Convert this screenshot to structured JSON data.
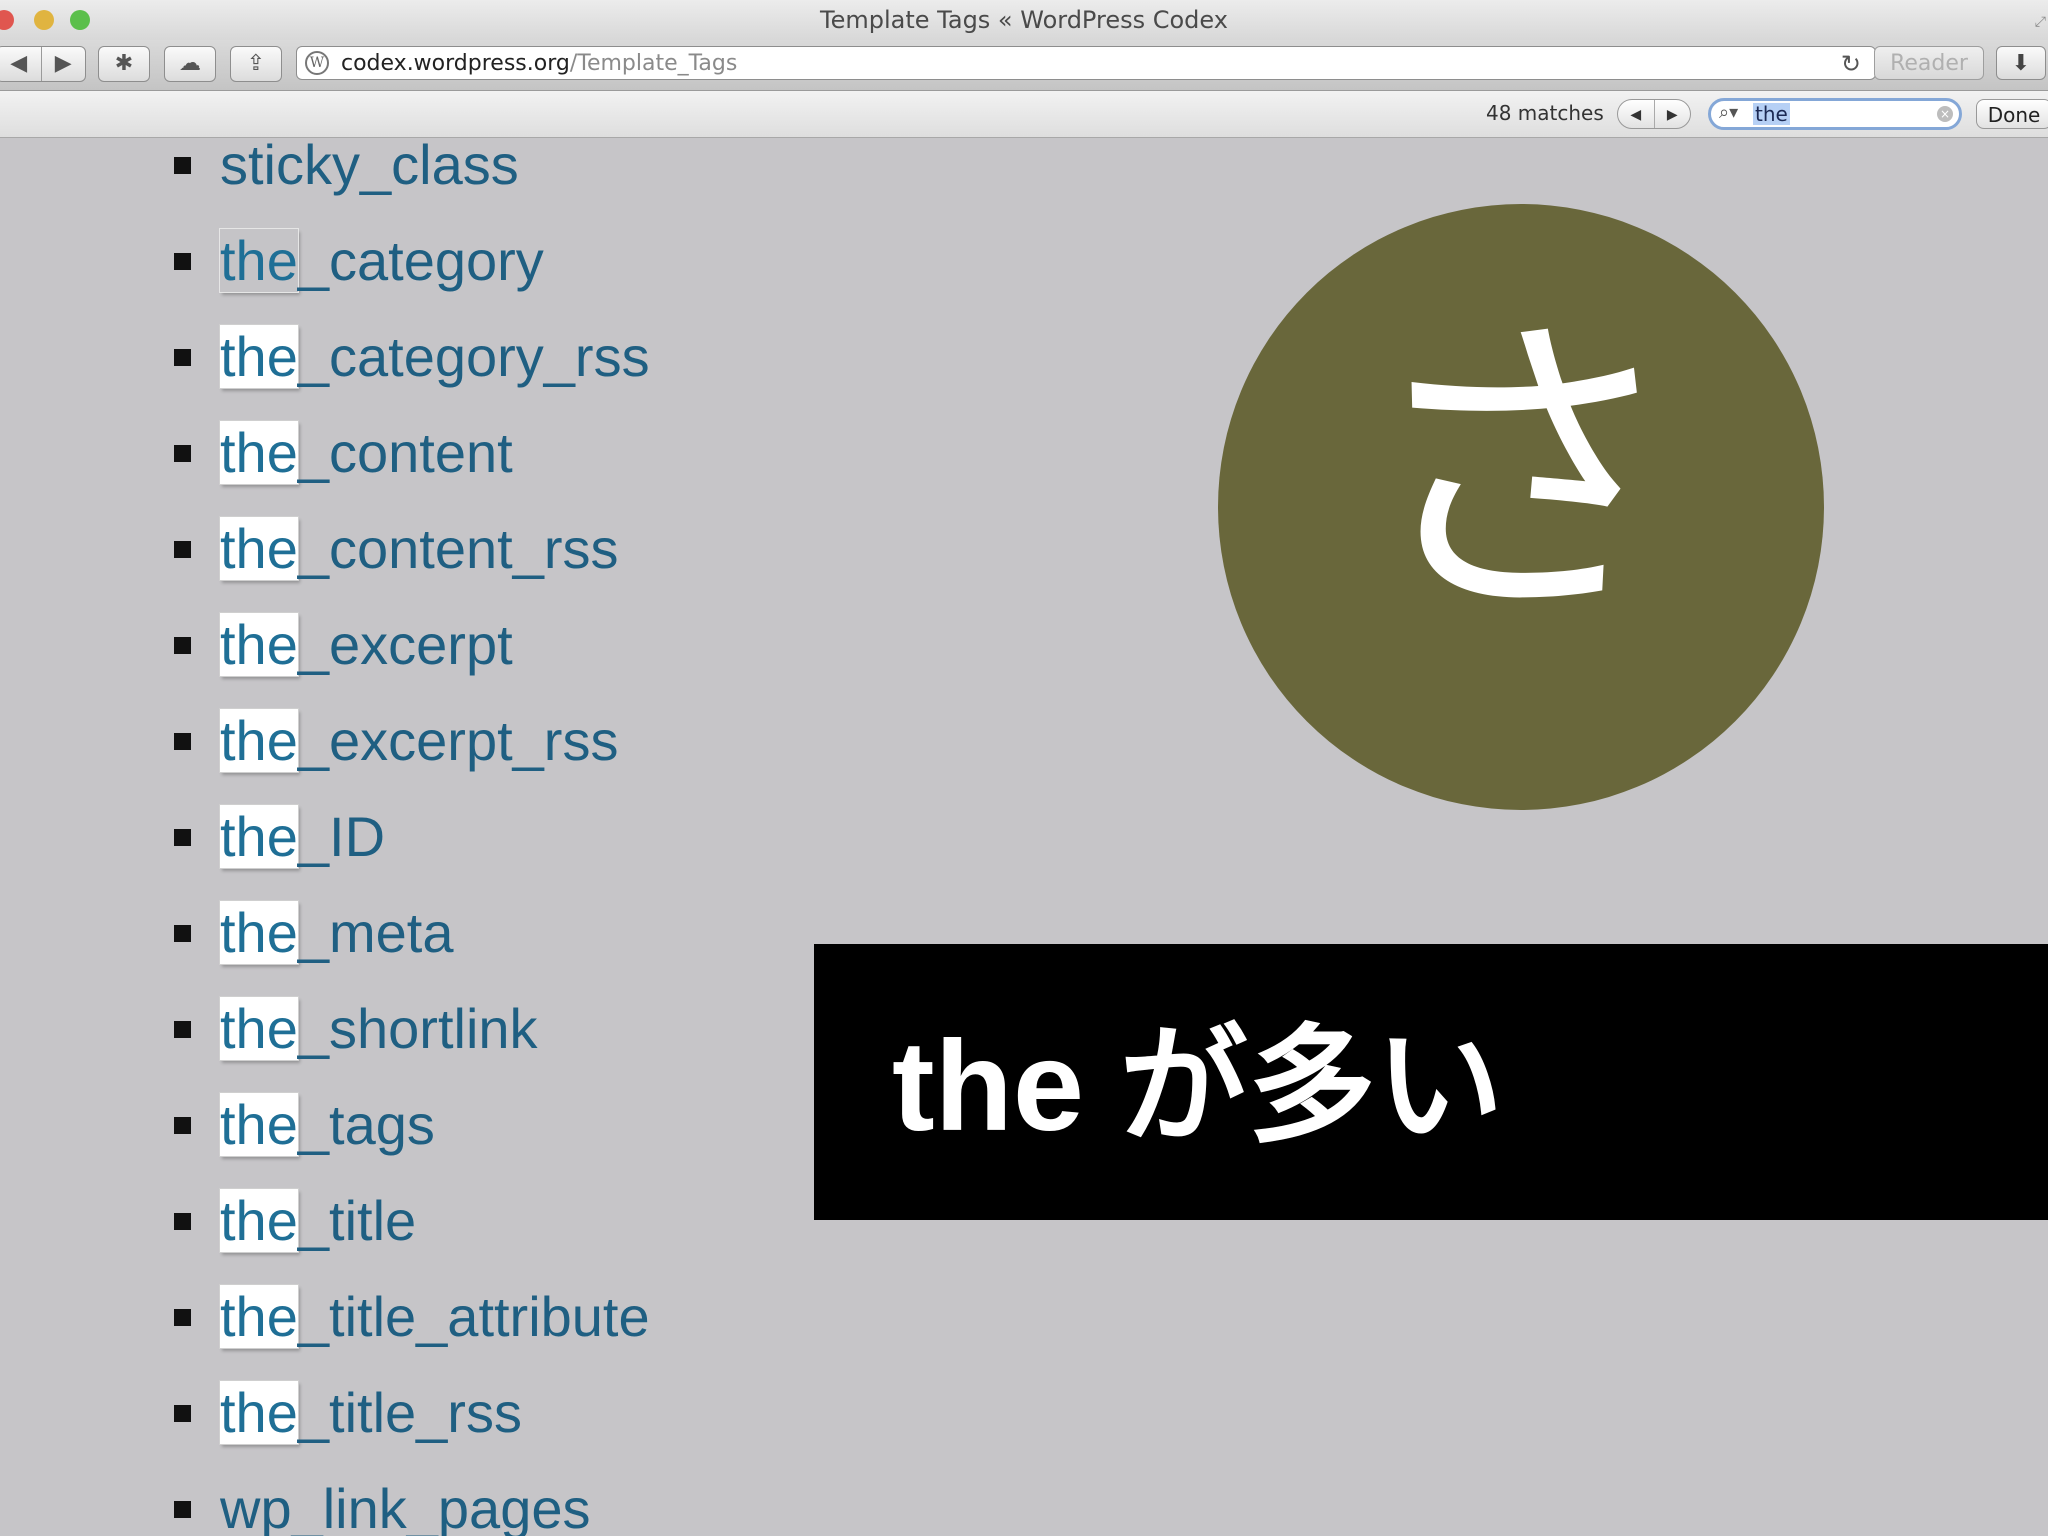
{
  "window": {
    "title": "Template Tags « WordPress Codex"
  },
  "toolbar": {
    "back_icon": "◀",
    "forward_icon": "▶",
    "topsites_icon": "✱",
    "icloud_icon": "☁",
    "share_icon": "⇪",
    "url_host": "codex.wordpress.org",
    "url_path": "/Template_Tags",
    "reload_icon": "↻",
    "reader_label": "Reader",
    "download_icon": "⬇"
  },
  "findbar": {
    "matches_label": "48 matches",
    "prev_icon": "◀",
    "next_icon": "▶",
    "search_icon": "🔍",
    "query": "the",
    "clear_icon": "×",
    "done_label": "Done"
  },
  "tags": [
    {
      "prefix": "",
      "rest": "sticky_class"
    },
    {
      "prefix": "the",
      "rest": "_category",
      "current": true
    },
    {
      "prefix": "the",
      "rest": "_category_rss"
    },
    {
      "prefix": "the",
      "rest": "_content"
    },
    {
      "prefix": "the",
      "rest": "_content_rss"
    },
    {
      "prefix": "the",
      "rest": "_excerpt"
    },
    {
      "prefix": "the",
      "rest": "_excerpt_rss"
    },
    {
      "prefix": "the",
      "rest": "_ID"
    },
    {
      "prefix": "the",
      "rest": "_meta"
    },
    {
      "prefix": "the",
      "rest": "_shortlink"
    },
    {
      "prefix": "the",
      "rest": "_tags"
    },
    {
      "prefix": "the",
      "rest": "_title"
    },
    {
      "prefix": "the",
      "rest": "_title_attribute"
    },
    {
      "prefix": "the",
      "rest": "_title_rss"
    },
    {
      "prefix": "",
      "rest": "wp_link_pages"
    }
  ],
  "overlay": {
    "circle_char": "さ",
    "circle_color": "#69673b",
    "banner_text": "the が多い"
  }
}
